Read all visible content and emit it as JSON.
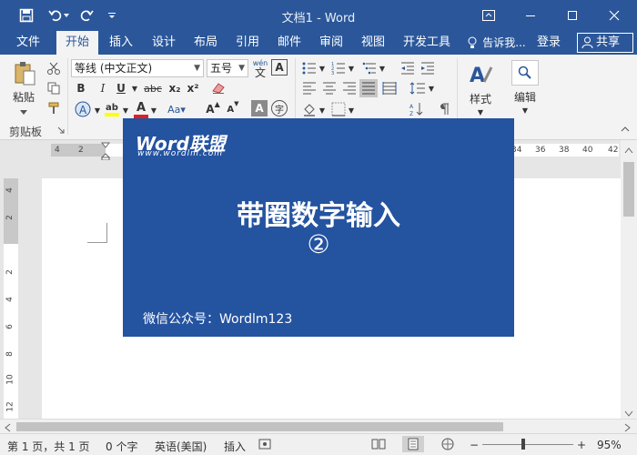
{
  "app": {
    "title": "文档1 - Word"
  },
  "tabs": [
    "文件",
    "开始",
    "插入",
    "设计",
    "布局",
    "引用",
    "邮件",
    "审阅",
    "视图",
    "开发工具"
  ],
  "tell_me": "告诉我...",
  "login": "登录",
  "share": "共享",
  "ribbon": {
    "clipboard_group": "剪贴板",
    "paste": "粘贴",
    "font_name": "等线 (中文正文)",
    "font_size": "五号",
    "wen_label": "wén",
    "wen_char": "文",
    "box_a": "A",
    "bold": "B",
    "italic": "I",
    "underline": "U",
    "strike": "abc",
    "subscript": "x₂",
    "superscript": "x²",
    "font_color": "A",
    "highlight": "ab",
    "char_shading": "A",
    "enclose_char": "字",
    "grow": "A",
    "shrink": "A",
    "styles": "样式",
    "edit": "编辑"
  },
  "ruler": {
    "h_numbers": [
      "4",
      "2",
      "34",
      "36",
      "38",
      "40",
      "42"
    ],
    "v_numbers": [
      "4",
      "2",
      "2",
      "4",
      "6",
      "8",
      "10",
      "12"
    ]
  },
  "status": {
    "page": "第 1 页，共 1 页",
    "words": "0 个字",
    "lang": "英语(美国)",
    "mode": "插入",
    "zoom": "95%",
    "minus": "−",
    "plus": "+"
  },
  "banner": {
    "logo": "Word联盟",
    "site": "www.wordlm.com",
    "headline": "带圈数字输入",
    "circled": "②",
    "wechat": "微信公众号：Wordlm123",
    "bg_color": "#2453a0"
  },
  "colors": {
    "accent": "#2b579a",
    "font_color_bar": "#e02020",
    "highlight_bar": "#ffff00"
  }
}
